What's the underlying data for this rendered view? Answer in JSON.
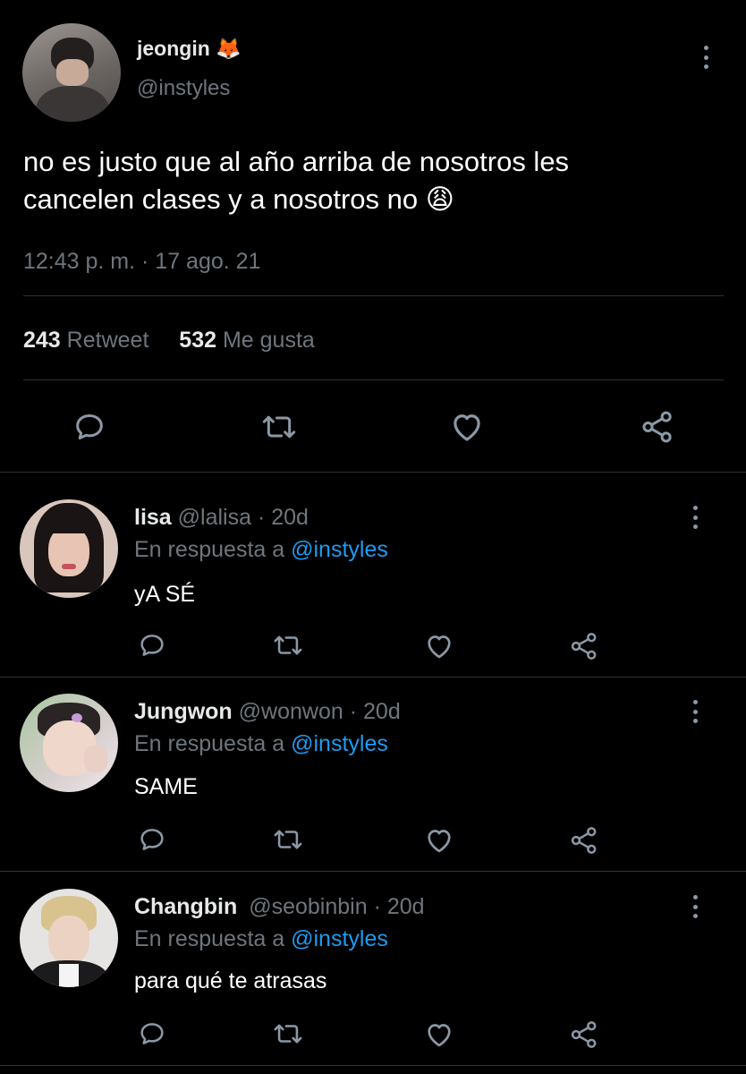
{
  "main_tweet": {
    "display_name": "jeongin",
    "name_emoji": "🦊",
    "handle": "@instyles",
    "text_line1": "no es justo que al año arriba de nosotros les",
    "text_line2": "cancelen clases y a nosotros no",
    "text_emoji": "😩",
    "timestamp": "12:43 p. m. · 17 ago. 21",
    "retweet_count": "243",
    "retweet_label": "Retweet",
    "like_count": "532",
    "like_label": "Me gusta"
  },
  "replies": [
    {
      "display_name": "lisa",
      "handle": "@lalisa",
      "age": "· 20d",
      "reply_prefix": "En respuesta a",
      "reply_to": "@instyles",
      "text": "yA SÉ"
    },
    {
      "display_name": "Jungwon",
      "handle": "@wonwon",
      "age": "· 20d",
      "reply_prefix": "En respuesta a",
      "reply_to": "@instyles",
      "text": "SAME"
    },
    {
      "display_name": "Changbin",
      "handle": "@seobinbin",
      "age": "· 20d",
      "reply_prefix": "En respuesta a",
      "reply_to": "@instyles",
      "text": "para qué te atrasas"
    }
  ],
  "icons": [
    "reply-icon",
    "retweet-icon",
    "like-icon",
    "share-icon",
    "more-options-icon"
  ],
  "colors": {
    "background": "#000000",
    "text": "#e7e9ea",
    "muted": "#6e767d",
    "link": "#1d9bf0",
    "divider": "#2f3336"
  }
}
